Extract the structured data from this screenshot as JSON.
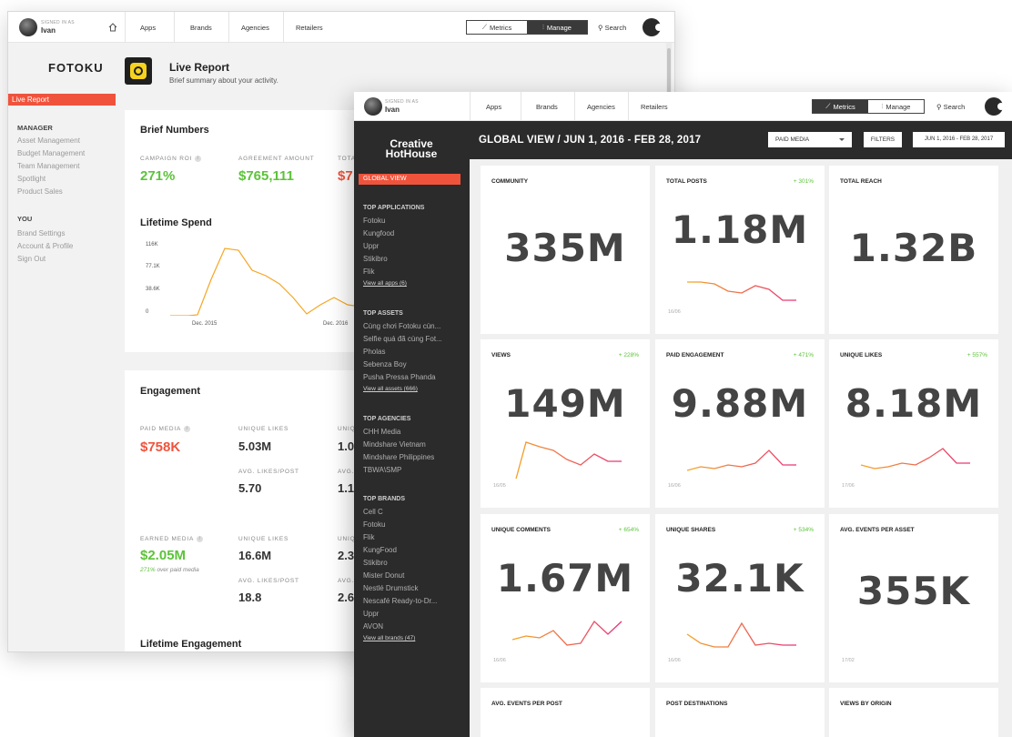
{
  "back_window": {
    "header": {
      "signed_in_as": "SIGNED IN AS",
      "user": "Ivan",
      "nav": [
        "Apps",
        "Brands",
        "Agencies",
        "Retailers"
      ],
      "metrics": "Metrics",
      "manage": "Manage",
      "search": "Search"
    },
    "sidebar": {
      "brand": "FOTOKU",
      "active": "Live Report",
      "manager_heading": "MANAGER",
      "manager_items": [
        "Asset Management",
        "Budget Management",
        "Team Management",
        "Spotlight",
        "Product Sales"
      ],
      "you_heading": "YOU",
      "you_items": [
        "Brand Settings",
        "Account & Profile",
        "Sign Out"
      ]
    },
    "page": {
      "title": "Live Report",
      "subtitle": "Brief summary about your activity."
    },
    "brief_numbers": {
      "title": "Brief Numbers",
      "campaign_roi_label": "CAMPAIGN ROI",
      "campaign_roi": "271%",
      "agreement_label": "AGREEMENT AMOUNT",
      "agreement_value": "$765,111",
      "third_label": "TOTA",
      "third_value": "$7"
    },
    "lifetime_spend": {
      "title": "Lifetime Spend",
      "chart_data": {
        "type": "line",
        "y_ticks": [
          "116K",
          "77.1K",
          "38.6K",
          "0"
        ],
        "x_ticks": [
          "Dec. 2015",
          "Dec. 2016"
        ],
        "color": "#f5a623"
      }
    },
    "engagement": {
      "title": "Engagement",
      "paid_label": "PAID MEDIA",
      "paid_value": "$758K",
      "unique_likes_label": "UNIQUE LIKES",
      "paid_unique_likes": "5.03M",
      "paid_col3_label": "UNIQ",
      "paid_col3_value": "1.0",
      "avg_label": "AVG. LIKES/POST",
      "paid_avg": "5.70",
      "paid_col3_avg_label": "AVG.",
      "paid_col3_avg": "1.1",
      "earned_label": "EARNED MEDIA",
      "earned_value": "$2.05M",
      "earned_note_pct": "271%",
      "earned_note_text": "over paid media",
      "earned_unique_likes": "16.6M",
      "earned_col3_label": "UNIQ",
      "earned_col3_value": "2.3",
      "earned_avg": "18.8",
      "earned_col3_avg_label": "AVG.",
      "earned_col3_avg": "2.6"
    },
    "lifetime_engagement": {
      "title": "Lifetime Engagement"
    }
  },
  "front_window": {
    "header": {
      "signed_in_as": "SIGNED IN AS",
      "user": "Ivan",
      "nav": [
        "Apps",
        "Brands",
        "Agencies",
        "Retailers"
      ],
      "metrics": "Metrics",
      "manage": "Manage",
      "search": "Search"
    },
    "sidebar": {
      "brand_line1": "Creative",
      "brand_line2": "HotHouse",
      "active": "GLOBAL VIEW",
      "top_applications": "TOP APPLICATIONS",
      "apps": [
        "Fotoku",
        "Kungfood",
        "Uppr",
        "Stikibro",
        "Flik"
      ],
      "apps_more": "View all apps (6)",
      "top_assets": "TOP ASSETS",
      "assets": [
        "Cùng chơi Fotoku cùn...",
        "Selfie quá đã cùng Fot...",
        "Pholas",
        "Sebenza Boy",
        "Pusha Pressa Phanda"
      ],
      "assets_more": "View all assets (666)",
      "top_agencies": "TOP AGENCIES",
      "agencies": [
        "CHH Media",
        "Mindshare Vietnam",
        "Mindshare Philippines",
        "TBWA\\SMP"
      ],
      "top_brands": "TOP BRANDS",
      "brands": [
        "Cell C",
        "Fotoku",
        "Flik",
        "KungFood",
        "Stikibro",
        "Mister Donut",
        "Nestlé Drumstick",
        "Nescafé Ready-to-Dr...",
        "Uppr",
        "AVON"
      ],
      "brands_more": "View all brands (47)"
    },
    "title_bar": {
      "title": "GLOBAL VIEW / JUN 1, 2016 - FEB 28, 2017",
      "media_select": "PAID MEDIA",
      "filters": "FILTERS",
      "date_range": "JUN 1, 2016 - FEB 28, 2017"
    },
    "metrics": [
      {
        "label": "COMMUNITY",
        "delta": "",
        "value": "335M",
        "date": ""
      },
      {
        "label": "TOTAL POSTS",
        "delta": "+ 301%",
        "value": "1.18M",
        "date": "16/06"
      },
      {
        "label": "TOTAL REACH",
        "delta": "",
        "value": "1.32B",
        "date": ""
      },
      {
        "label": "VIEWS",
        "delta": "+ 228%",
        "value": "149M",
        "date": "16/05"
      },
      {
        "label": "PAID ENGAGEMENT",
        "delta": "+ 471%",
        "value": "9.88M",
        "date": "16/06"
      },
      {
        "label": "UNIQUE LIKES",
        "delta": "+ 557%",
        "value": "8.18M",
        "date": "17/06"
      },
      {
        "label": "UNIQUE COMMENTS",
        "delta": "+ 654%",
        "value": "1.67M",
        "date": "16/06"
      },
      {
        "label": "UNIQUE SHARES",
        "delta": "+ 534%",
        "value": "32.1K",
        "date": "16/06"
      },
      {
        "label": "AVG. EVENTS PER ASSET",
        "delta": "",
        "value": "355K",
        "date": "17/02"
      },
      {
        "label": "AVG. EVENTS PER POST",
        "delta": "",
        "value": "",
        "date": ""
      },
      {
        "label": "POST DESTINATIONS",
        "delta": "",
        "value": "",
        "date": ""
      },
      {
        "label": "VIEWS BY ORIGIN",
        "delta": "",
        "value": "",
        "date": ""
      }
    ],
    "spark_colors": {
      "start": "#f5a623",
      "end": "#e8317a"
    }
  }
}
